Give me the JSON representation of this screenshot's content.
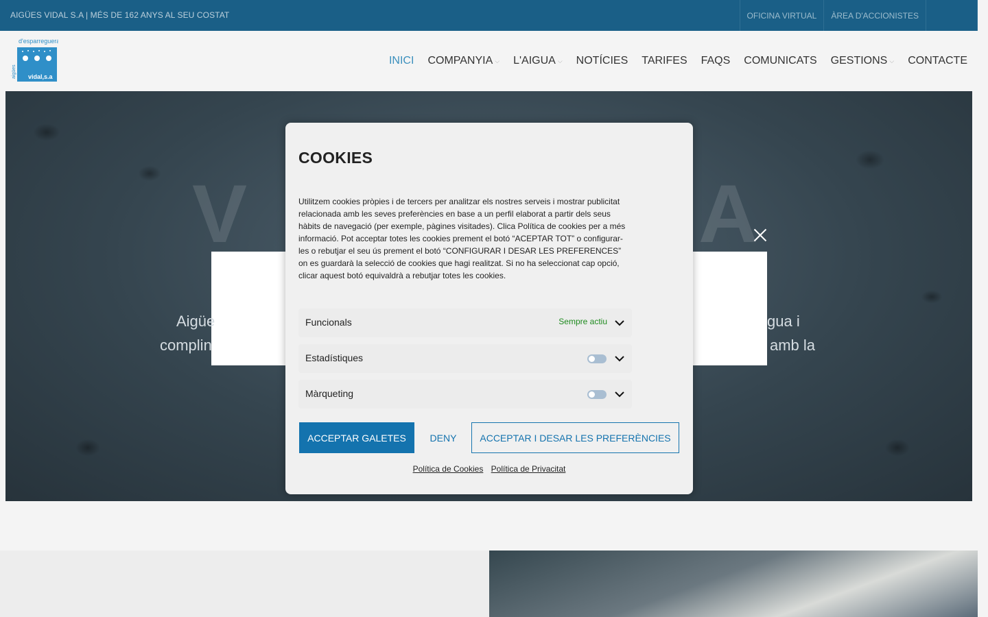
{
  "topbar": {
    "tagline": "AIGÜES VIDAL S.A | MÉS DE 162 ANYS AL SEU COSTAT",
    "links": [
      "OFICINA VIRTUAL",
      "ÀREA D'ACCIONISTES"
    ]
  },
  "logo": {
    "top_text": "d'esparreguera",
    "side_text": "aigües",
    "bottom_text": "vidal,s.a"
  },
  "nav": {
    "items": [
      {
        "label": "INICI"
      },
      {
        "label": "COMPANYIA"
      },
      {
        "label": "L'AIGUA"
      },
      {
        "label": "NOTÍCIES"
      },
      {
        "label": "TARIFES"
      },
      {
        "label": "FAQS"
      },
      {
        "label": "COMUNICATS"
      },
      {
        "label": "GESTIONS"
      },
      {
        "label": "CONTACTE"
      }
    ]
  },
  "hero": {
    "big_left": "V",
    "big_right": "A",
    "text_left_1": "Aigüe",
    "text_left_2": "complin",
    "text_right_1": "gua i",
    "text_right_2": "amb la"
  },
  "cookie_modal": {
    "title": "COOKIES",
    "body": "Utilitzem cookies pròpies i de tercers per analitzar els nostres serveis i mostrar publicitat relacionada amb les seves preferències en base a un perfil elaborat a partir dels seus hàbits de navegació (per exemple, pàgines visitades). Clica Política de cookies per a més informació. Pot acceptar totes les cookies prement el botó “ACEPTAR TOT” o configurar-les o rebutjar el seu ús prement el botó “CONFIGURAR I DESAR LES PREFERENCES” on es guardarà la selecció de cookies que hagi realitzat. Si no ha seleccionat cap opció, clicar aquest botó equivaldrà a rebutjar totes les cookies.",
    "categories": [
      {
        "label": "Funcionals",
        "status": "Sempre actiu"
      },
      {
        "label": "Estadístiques"
      },
      {
        "label": "Màrqueting"
      }
    ],
    "accept_button": "ACCEPTAR GALETES",
    "deny_button": "DENY",
    "save_button": "ACCEPTAR I DESAR LES PREFERÈNCIES",
    "cookie_policy_link": "Política de Cookies",
    "privacy_policy_link": "Política de Privacitat"
  },
  "colors": {
    "topbar": "#1a5f87",
    "accent": "#1473ae",
    "active_nav": "#3a8fbd",
    "always_active": "#1e8a1e"
  }
}
